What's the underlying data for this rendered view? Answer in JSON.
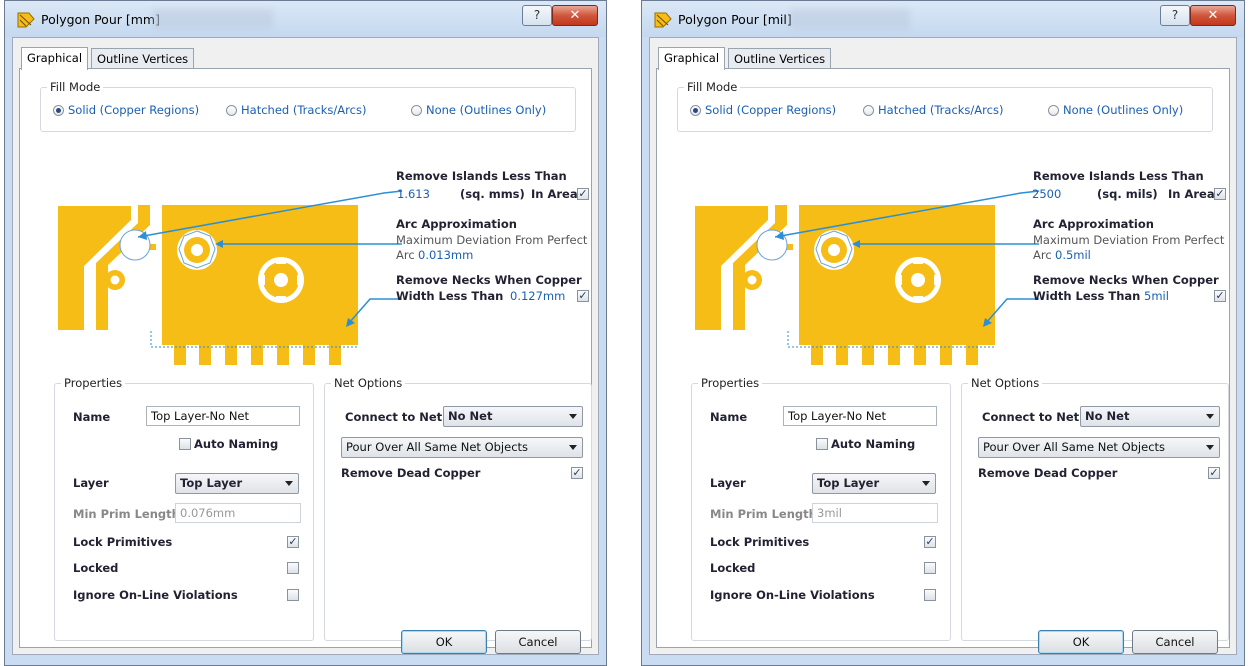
{
  "dialogs": [
    {
      "title": "Polygon Pour [mm]",
      "tabs": [
        "Graphical",
        "Outline Vertices"
      ],
      "fill_mode": {
        "label": "Fill Mode",
        "options": [
          "Solid (Copper Regions)",
          "Hatched (Tracks/Arcs)",
          "None (Outlines Only)"
        ],
        "selected": "Solid (Copper Regions)"
      },
      "islands": {
        "label": "Remove Islands Less Than",
        "value": "1.613",
        "unit": "(sq. mms)",
        "suffix": "In Area",
        "checked": true
      },
      "arc": {
        "label": "Arc Approximation",
        "desc": "Maximum Deviation From Perfect",
        "prefix": "Arc",
        "value": "0.013mm"
      },
      "necks": {
        "label1": "Remove Necks When Copper",
        "label2": "Width Less Than",
        "value": "0.127mm",
        "checked": true
      },
      "properties": {
        "label": "Properties",
        "name_label": "Name",
        "name_value": "Top Layer-No Net",
        "auto_naming": "Auto Naming",
        "auto_naming_checked": false,
        "layer_label": "Layer",
        "layer_value": "Top Layer",
        "min_prim_label": "Min Prim Length",
        "min_prim_value": "0.076mm",
        "lock_primitives": "Lock Primitives",
        "lock_primitives_checked": true,
        "locked": "Locked",
        "locked_checked": false,
        "ignore_violations": "Ignore On-Line Violations",
        "ignore_violations_checked": false
      },
      "net_options": {
        "label": "Net Options",
        "connect_label": "Connect to Net",
        "connect_value": "No Net",
        "pour_over": "Pour Over All Same Net Objects",
        "remove_dead": "Remove Dead Copper",
        "remove_dead_checked": true
      },
      "buttons": {
        "ok": "OK",
        "cancel": "Cancel"
      }
    },
    {
      "title": "Polygon Pour [mil]",
      "tabs": [
        "Graphical",
        "Outline Vertices"
      ],
      "fill_mode": {
        "label": "Fill Mode",
        "options": [
          "Solid (Copper Regions)",
          "Hatched (Tracks/Arcs)",
          "None (Outlines Only)"
        ],
        "selected": "Solid (Copper Regions)"
      },
      "islands": {
        "label": "Remove Islands Less Than",
        "value": "2500",
        "unit": "(sq. mils)",
        "suffix": "In Area",
        "checked": true
      },
      "arc": {
        "label": "Arc Approximation",
        "desc": "Maximum Deviation From Perfect",
        "prefix": "Arc",
        "value": "0.5mil"
      },
      "necks": {
        "label1": "Remove Necks When Copper",
        "label2": "Width Less Than",
        "value": "5mil",
        "checked": true
      },
      "properties": {
        "label": "Properties",
        "name_label": "Name",
        "name_value": "Top Layer-No Net",
        "auto_naming": "Auto Naming",
        "auto_naming_checked": false,
        "layer_label": "Layer",
        "layer_value": "Top Layer",
        "min_prim_label": "Min Prim Length",
        "min_prim_value": "3mil",
        "lock_primitives": "Lock Primitives",
        "lock_primitives_checked": true,
        "locked": "Locked",
        "locked_checked": false,
        "ignore_violations": "Ignore On-Line Violations",
        "ignore_violations_checked": false
      },
      "net_options": {
        "label": "Net Options",
        "connect_label": "Connect to Net",
        "connect_value": "No Net",
        "pour_over": "Pour Over All Same Net Objects",
        "remove_dead": "Remove Dead Copper",
        "remove_dead_checked": true
      },
      "buttons": {
        "ok": "OK",
        "cancel": "Cancel"
      }
    }
  ],
  "window_controls": {
    "help": "?",
    "close": "✕"
  },
  "colors": {
    "copper": "#f6bd16",
    "arrow": "#2c8fd6",
    "link_blue": "#1a5fb4",
    "close_red": "#c8432a"
  },
  "icons": [
    "polygon-pour-icon",
    "help-icon",
    "close-icon",
    "checkmark-icon",
    "dropdown-arrow-icon"
  ]
}
